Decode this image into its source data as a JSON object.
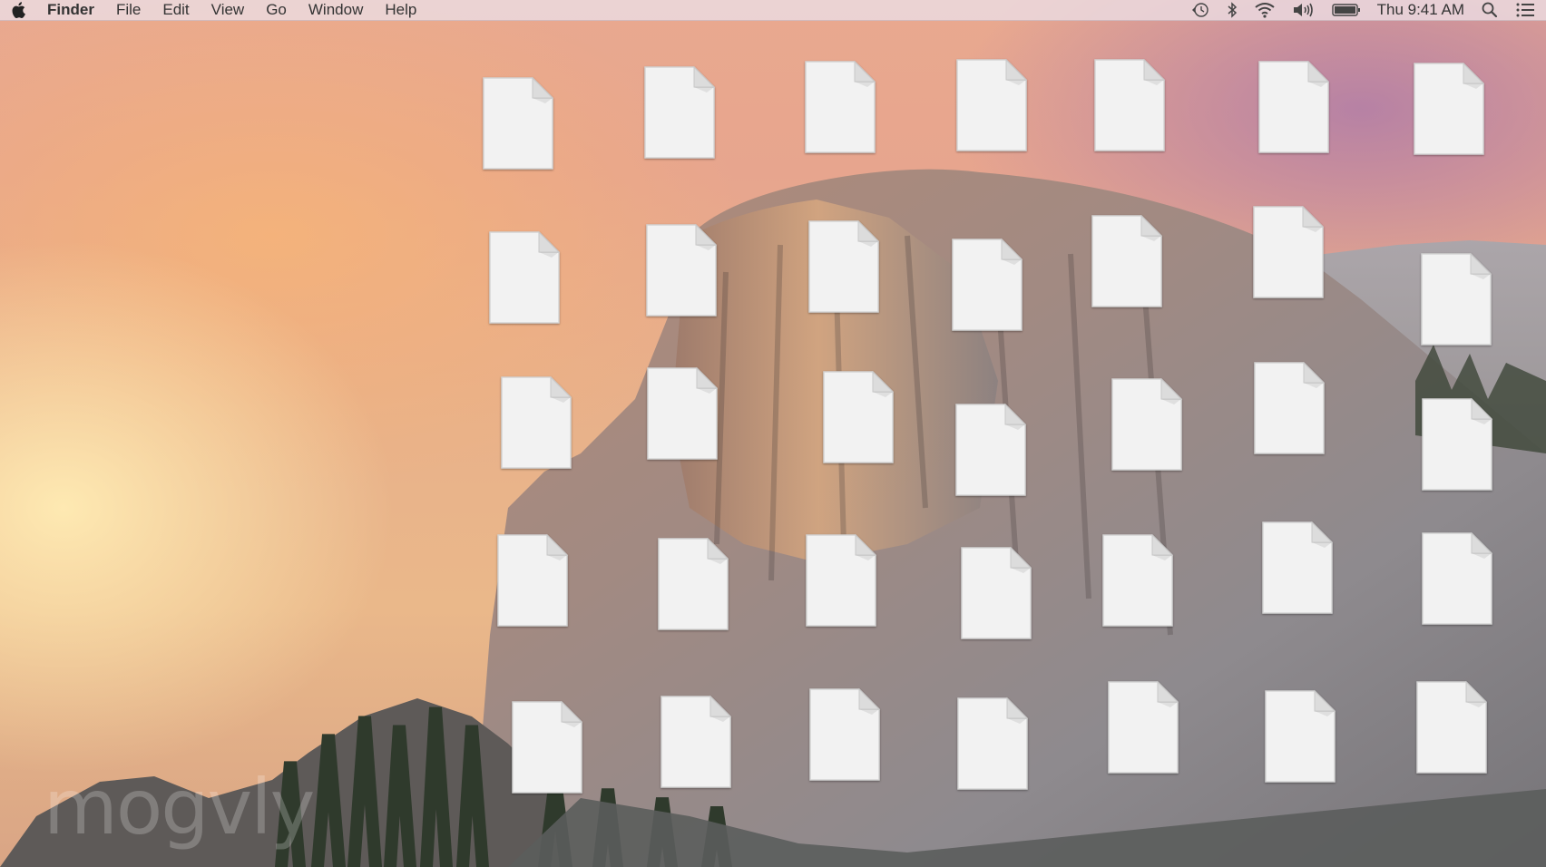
{
  "menubar": {
    "apple_icon": "apple-icon",
    "app_name": "Finder",
    "menus": [
      "File",
      "Edit",
      "View",
      "Go",
      "Window",
      "Help"
    ],
    "status_icons": [
      "time-machine-icon",
      "bluetooth-icon",
      "wifi-icon",
      "volume-icon",
      "battery-icon"
    ],
    "clock": "Thu 9:41 AM",
    "right_icons": [
      "spotlight-search-icon",
      "notification-center-icon"
    ]
  },
  "desktop": {
    "icon_type": "document-icon",
    "rows": 5,
    "columns": 7,
    "icon_count": 35
  },
  "watermark": {
    "text": "mogvly"
  },
  "colors": {
    "sky_top": "#e7a58e",
    "sky_glow": "#ffecb4",
    "rock": "#8f8684",
    "menubar_bg": "#ecdce2",
    "doc_fill": "#f2f2f2"
  }
}
